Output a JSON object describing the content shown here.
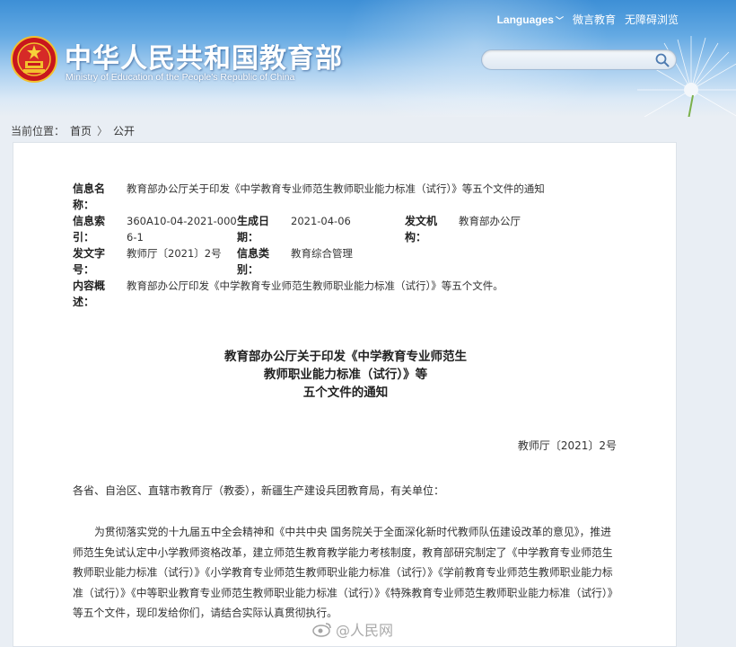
{
  "header": {
    "site_title": "中华人民共和国教育部",
    "site_subtitle": "Ministry of Education of the People's Republic of China",
    "links": {
      "languages": "Languages",
      "weibo": "微言教育",
      "accessible": "无障碍浏览"
    },
    "search": {
      "placeholder": "",
      "value": ""
    }
  },
  "breadcrumb": {
    "prefix": "当前位置：",
    "home": "首页",
    "separator": "〉",
    "section": "公开"
  },
  "meta": {
    "info_name_label": "信息名称：",
    "info_name_value": "教育部办公厅关于印发《中学教育专业师范生教师职业能力标准（试行）》等五个文件的通知",
    "index_label": "信息索引：",
    "index_value": "360A10-04-2021-0006-1",
    "date_label": "生成日期：",
    "date_value": "2021-04-06",
    "issuer_label": "发文机构：",
    "issuer_value": "教育部办公厅",
    "docno_label": "发文字号：",
    "docno_value": "教师厅〔2021〕2号",
    "category_label": "信息类别：",
    "category_value": "教育综合管理",
    "summary_label": "内容概述：",
    "summary_value": "教育部办公厅印发《中学教育专业师范生教师职业能力标准（试行）》等五个文件。"
  },
  "document": {
    "title_line1": "教育部办公厅关于印发《中学教育专业师范生",
    "title_line2": "教师职业能力标准（试行）》等",
    "title_line3": "五个文件的通知",
    "number": "教师厅〔2021〕2号",
    "salutation": "各省、自治区、直辖市教育厅（教委），新疆生产建设兵团教育局，有关单位：",
    "body": "为贯彻落实党的十九届五中全会精神和《中共中央 国务院关于全面深化新时代教师队伍建设改革的意见》，推进师范生免试认定中小学教师资格改革，建立师范生教育教学能力考核制度，教育部研究制定了《中学教育专业师范生教师职业能力标准（试行）》《小学教育专业师范生教师职业能力标准（试行）》《学前教育专业师范生教师职业能力标准（试行）》《中等职业教育专业师范生教师职业能力标准（试行）》《特殊教育专业师范生教师职业能力标准（试行）》等五个文件，现印发给你们，请结合实际认真贯彻执行。"
  },
  "watermark": {
    "text": "@人民网"
  }
}
